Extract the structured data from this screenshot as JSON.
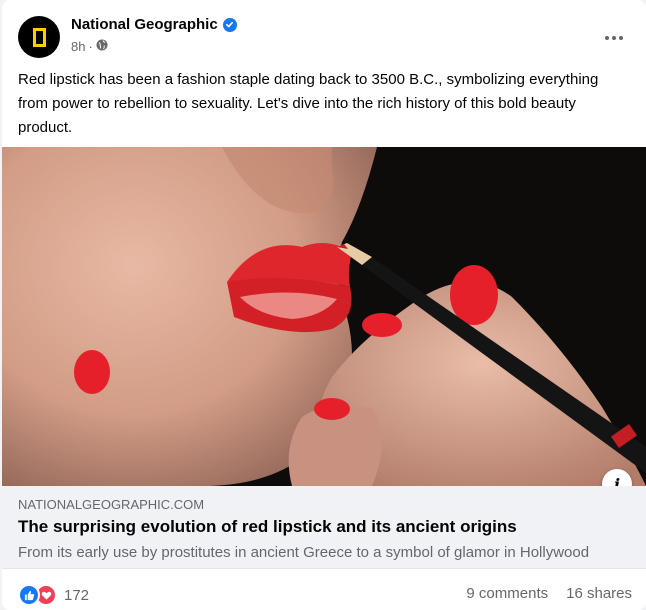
{
  "post": {
    "page_name": "National Geographic",
    "timestamp": "8h",
    "separator": "·",
    "audience_icon": "globe-icon",
    "text": "Red lipstick has been a fashion staple dating back to 3500 B.C., symbolizing everything from power to rebellion to sexuality. Let's dive into the rich history of this bold beauty product."
  },
  "link_preview": {
    "domain": "NATIONALGEOGRAPHIC.COM",
    "title": "The surprising evolution of red lipstick and its ancient origins",
    "description": "From its early use by prostitutes in ancient Greece to a symbol of glamor in Hollywood"
  },
  "footer": {
    "reaction_count": "172",
    "comments": "9 comments",
    "shares": "16 shares"
  },
  "colors": {
    "brand_blue": "#1877f2",
    "love_red": "#f33e58",
    "lipstick_red": "#e0262d",
    "logo_yellow": "#ffce00"
  }
}
